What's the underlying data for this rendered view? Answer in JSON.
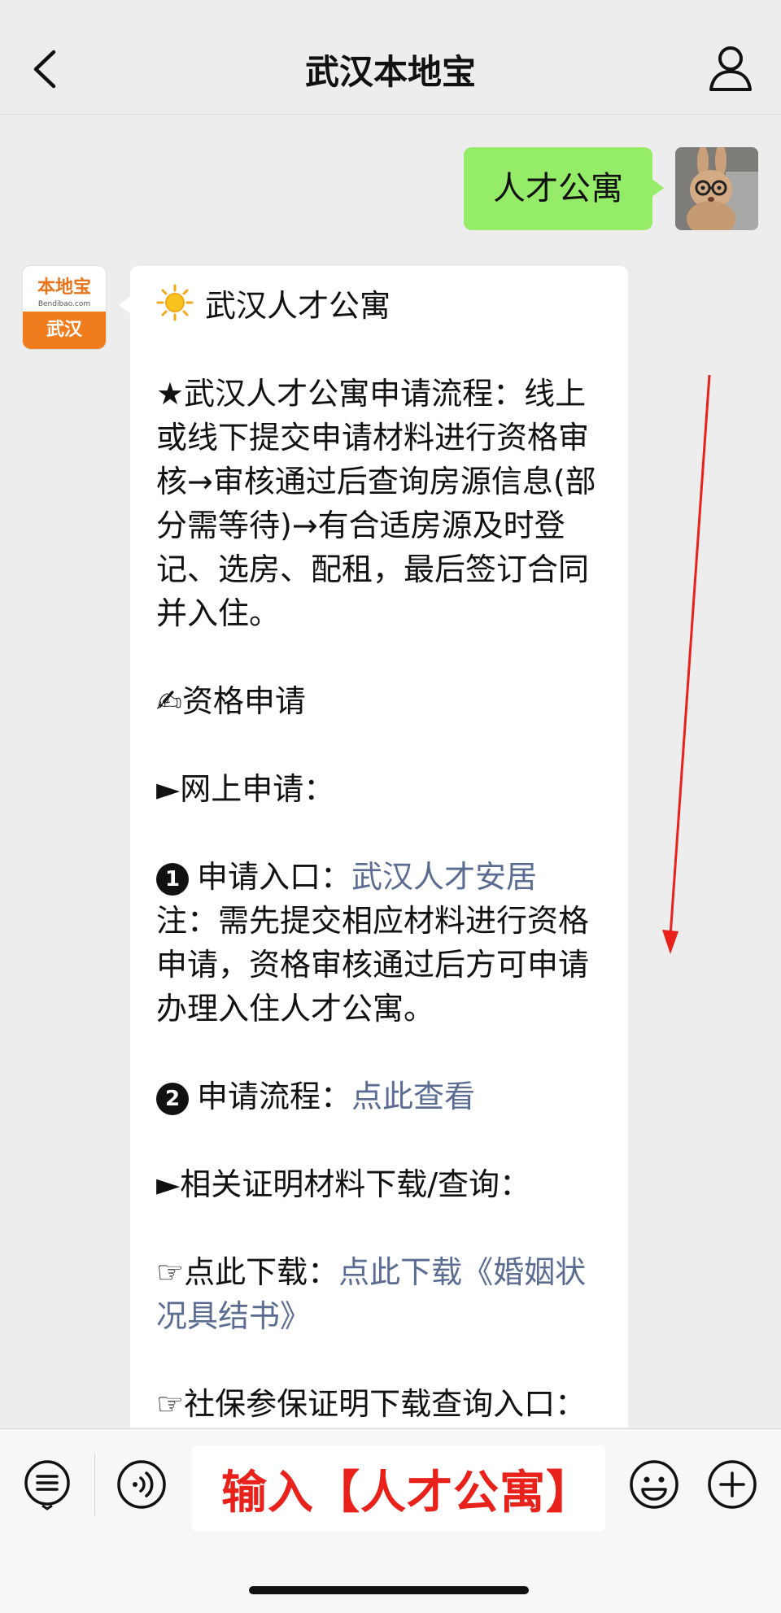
{
  "header": {
    "title": "武汉本地宝",
    "back_icon": "chevron-left-icon",
    "profile_icon": "person-icon"
  },
  "user_message": {
    "text": "人才公寓"
  },
  "bot": {
    "avatar_brand": "本地宝",
    "avatar_domain": "Bendibao.com",
    "avatar_city": "武汉",
    "reply": {
      "heading": "武汉人才公寓",
      "flow": "★武汉人才公寓申请流程：线上或线下提交申请材料进行资格审核→审核通过后查询房源信息(部分需等待)→有合适房源及时登记、选房、配租，最后签订合同并入住。",
      "section_qualification": "✍资格申请",
      "online_apply": "►网上申请：",
      "entry_label": "申请入口：",
      "entry_link": "武汉人才安居",
      "entry_note": "注：需先提交相应材料进行资格申请，资格审核通过后方可申请办理入住人才公寓。",
      "process_label": "申请流程：",
      "process_link": "点此查看",
      "materials": "►相关证明材料下载/查询：",
      "download_label": "☞点此下载：",
      "download_link": "点此下载《婚姻状况具结书》",
      "social_label": "☞社保参保证明下载查询入口：",
      "social_link": "#",
      "bullet_1": "1",
      "bullet_2": "2"
    }
  },
  "input": {
    "value": "输入【人才公寓】"
  },
  "colors": {
    "accent_green": "#95ec69",
    "link": "#5b6c93",
    "brand_orange": "#f07c1d",
    "annotation_red": "#e8221b"
  }
}
